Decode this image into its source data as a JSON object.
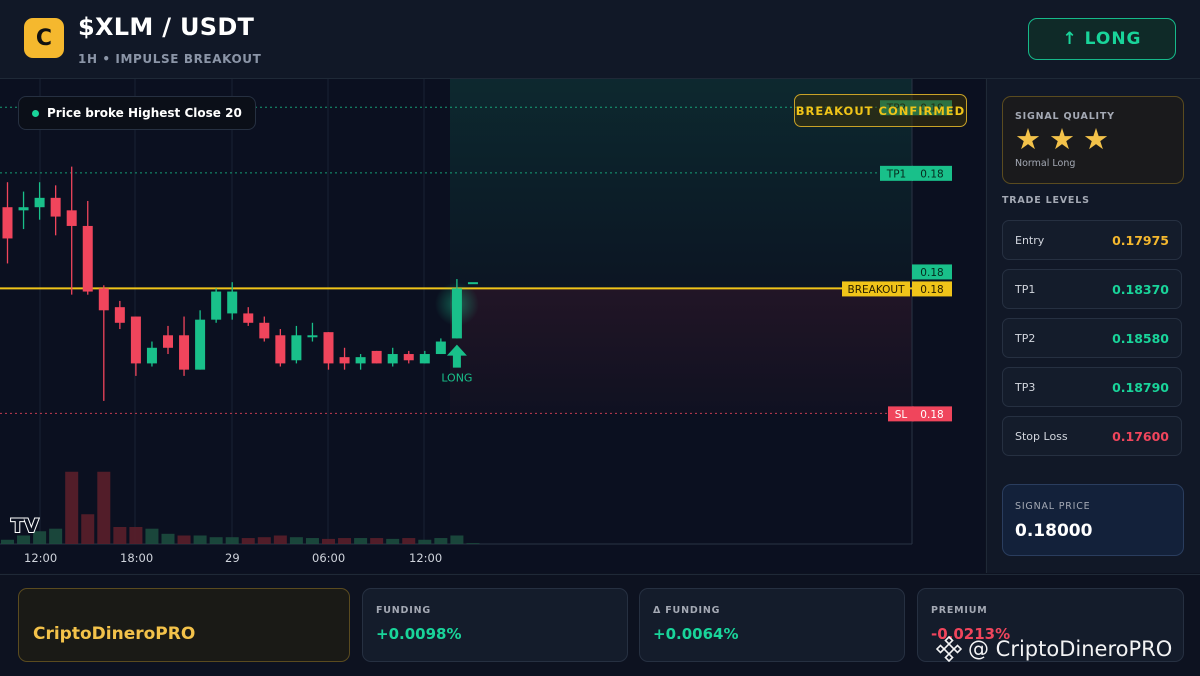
{
  "header": {
    "logo_letter": "C",
    "pair": "$XLM / USDT",
    "subtitle": "1H • IMPULSE BREAKOUT",
    "direction_button": "↑ LONG"
  },
  "chart": {
    "price_badge": "Price broke Highest Close 20",
    "breakout_confirmed": "BREAKOUT CONFIRMED",
    "lines": {
      "tp2_label": "TP2",
      "tp2_value": "0.19",
      "tp1_label": "TP1",
      "tp1_value": "0.18",
      "current_value": "0.18",
      "breakout_label": "BREAKOUT",
      "breakout_value": "0.18",
      "sl_label": "SL",
      "sl_value": "0.18"
    },
    "signal_marker": "LONG",
    "tradingview_logo": "TV",
    "x_ticks": [
      "12:00",
      "18:00",
      "29",
      "06:00",
      "12:00"
    ],
    "colors": {
      "up": "#19c08a",
      "down": "#f0455c",
      "breakout": "#f0c419"
    }
  },
  "chart_data": {
    "type": "candlestick",
    "title": "$XLM / USDT",
    "subtitle": "1H • IMPULSE BREAKOUT",
    "x_ticks": [
      "12:00",
      "18:00",
      "29",
      "06:00",
      "12:00"
    ],
    "price_levels": {
      "tp2": 0.1858,
      "tp1": 0.1837,
      "breakout": 0.18,
      "entry": 0.17975,
      "stop_loss": 0.176
    },
    "candles": [
      {
        "o": 0.1826,
        "h": 0.1834,
        "l": 0.1808,
        "c": 0.1816
      },
      {
        "o": 0.1825,
        "h": 0.1831,
        "l": 0.1819,
        "c": 0.1826
      },
      {
        "o": 0.1826,
        "h": 0.1834,
        "l": 0.1822,
        "c": 0.1829
      },
      {
        "o": 0.1829,
        "h": 0.1833,
        "l": 0.1817,
        "c": 0.1823
      },
      {
        "o": 0.1825,
        "h": 0.1839,
        "l": 0.1798,
        "c": 0.182
      },
      {
        "o": 0.182,
        "h": 0.1828,
        "l": 0.1798,
        "c": 0.1799
      },
      {
        "o": 0.18,
        "h": 0.1801,
        "l": 0.1764,
        "c": 0.1793
      },
      {
        "o": 0.1794,
        "h": 0.1796,
        "l": 0.1787,
        "c": 0.1789
      },
      {
        "o": 0.1791,
        "h": 0.1791,
        "l": 0.1772,
        "c": 0.1776
      },
      {
        "o": 0.1776,
        "h": 0.1783,
        "l": 0.1775,
        "c": 0.1781
      },
      {
        "o": 0.1785,
        "h": 0.1788,
        "l": 0.1779,
        "c": 0.1781
      },
      {
        "o": 0.1785,
        "h": 0.1791,
        "l": 0.1772,
        "c": 0.1774
      },
      {
        "o": 0.1774,
        "h": 0.1793,
        "l": 0.1774,
        "c": 0.179
      },
      {
        "o": 0.179,
        "h": 0.18,
        "l": 0.1789,
        "c": 0.1799
      },
      {
        "o": 0.1792,
        "h": 0.1802,
        "l": 0.179,
        "c": 0.1799
      },
      {
        "o": 0.1792,
        "h": 0.1794,
        "l": 0.1788,
        "c": 0.1789
      },
      {
        "o": 0.1789,
        "h": 0.1791,
        "l": 0.1783,
        "c": 0.1784
      },
      {
        "o": 0.1785,
        "h": 0.1787,
        "l": 0.1775,
        "c": 0.1776
      },
      {
        "o": 0.1777,
        "h": 0.1788,
        "l": 0.1776,
        "c": 0.1785
      },
      {
        "o": 0.1785,
        "h": 0.1789,
        "l": 0.1783,
        "c": 0.1785
      },
      {
        "o": 0.1786,
        "h": 0.1786,
        "l": 0.1774,
        "c": 0.1776
      },
      {
        "o": 0.1778,
        "h": 0.1781,
        "l": 0.1774,
        "c": 0.1776
      },
      {
        "o": 0.1776,
        "h": 0.1779,
        "l": 0.1774,
        "c": 0.1778
      },
      {
        "o": 0.178,
        "h": 0.178,
        "l": 0.1776,
        "c": 0.1776
      },
      {
        "o": 0.1776,
        "h": 0.1781,
        "l": 0.1775,
        "c": 0.1779
      },
      {
        "o": 0.1779,
        "h": 0.178,
        "l": 0.1776,
        "c": 0.1777
      },
      {
        "o": 0.1776,
        "h": 0.178,
        "l": 0.1776,
        "c": 0.1779
      },
      {
        "o": 0.1779,
        "h": 0.1784,
        "l": 0.1779,
        "c": 0.1783
      },
      {
        "o": 0.1784,
        "h": 0.1803,
        "l": 0.1784,
        "c": 0.18
      },
      {
        "o": 0.1802,
        "h": 0.1802,
        "l": 0.1802,
        "c": 0.1802
      }
    ],
    "volumes": [
      0.05,
      0.1,
      0.15,
      0.18,
      0.85,
      0.35,
      0.85,
      0.2,
      0.2,
      0.18,
      0.12,
      0.1,
      0.1,
      0.08,
      0.08,
      0.07,
      0.08,
      0.1,
      0.08,
      0.07,
      0.06,
      0.07,
      0.07,
      0.07,
      0.06,
      0.07,
      0.05,
      0.07,
      0.1,
      0.01
    ],
    "volume_directions": [
      "up",
      "up",
      "up",
      "up",
      "down",
      "down",
      "down",
      "down",
      "down",
      "up",
      "up",
      "down",
      "up",
      "up",
      "up",
      "down",
      "down",
      "down",
      "up",
      "up",
      "down",
      "down",
      "up",
      "down",
      "up",
      "down",
      "up",
      "up",
      "up",
      "up"
    ],
    "ylim": [
      0.1755,
      0.186
    ]
  },
  "sidebar": {
    "quality_title": "SIGNAL QUALITY",
    "stars": 3,
    "quality_label": "Normal Long",
    "levels_title": "TRADE LEVELS",
    "levels": [
      {
        "label": "Entry",
        "value": "0.17975",
        "color": "#f5b82e"
      },
      {
        "label": "TP1",
        "value": "0.18370",
        "color": "#19d49a"
      },
      {
        "label": "TP2",
        "value": "0.18580",
        "color": "#19d49a"
      },
      {
        "label": "TP3",
        "value": "0.18790",
        "color": "#19d49a"
      },
      {
        "label": "Stop Loss",
        "value": "0.17600",
        "color": "#f0455c"
      }
    ],
    "signal_price_title": "SIGNAL PRICE",
    "signal_price": "0.18000"
  },
  "footer": {
    "brand": "CriptoDineroPRO",
    "stats": [
      {
        "title": "FUNDING",
        "value": "+0.0098%",
        "color": "#19d49a"
      },
      {
        "title": "Δ FUNDING",
        "value": "+0.0064%",
        "color": "#19d49a"
      },
      {
        "title": "PREMIUM",
        "value": "-0.0213%",
        "color": "#f0455c"
      }
    ],
    "watermark": "@ CriptoDineroPRO"
  }
}
